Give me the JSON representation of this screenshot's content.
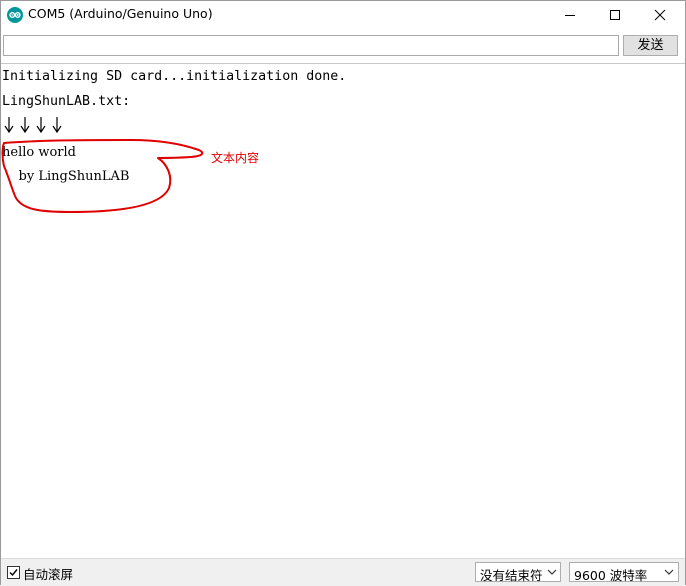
{
  "window": {
    "title": "COM5 (Arduino/Genuino Uno)",
    "app_icon": "arduino-icon",
    "controls": [
      "minimize-icon",
      "maximize-icon",
      "close-icon"
    ]
  },
  "input_row": {
    "input_value": "",
    "send_label": "发送"
  },
  "output": {
    "lines": [
      "Initializing SD card...initialization done.",
      "LingShunLAB.txt:",
      "hello world",
      "    by LingShunLAB"
    ],
    "arrows": "↓↓↓↓",
    "annotation_label": "文本内容",
    "annotation_color": "#e00000"
  },
  "status_bar": {
    "autoscroll_label": "自动滚屏",
    "autoscroll_checked": true,
    "line_ending": "没有结束符",
    "baud_rate": "9600 波特率"
  }
}
